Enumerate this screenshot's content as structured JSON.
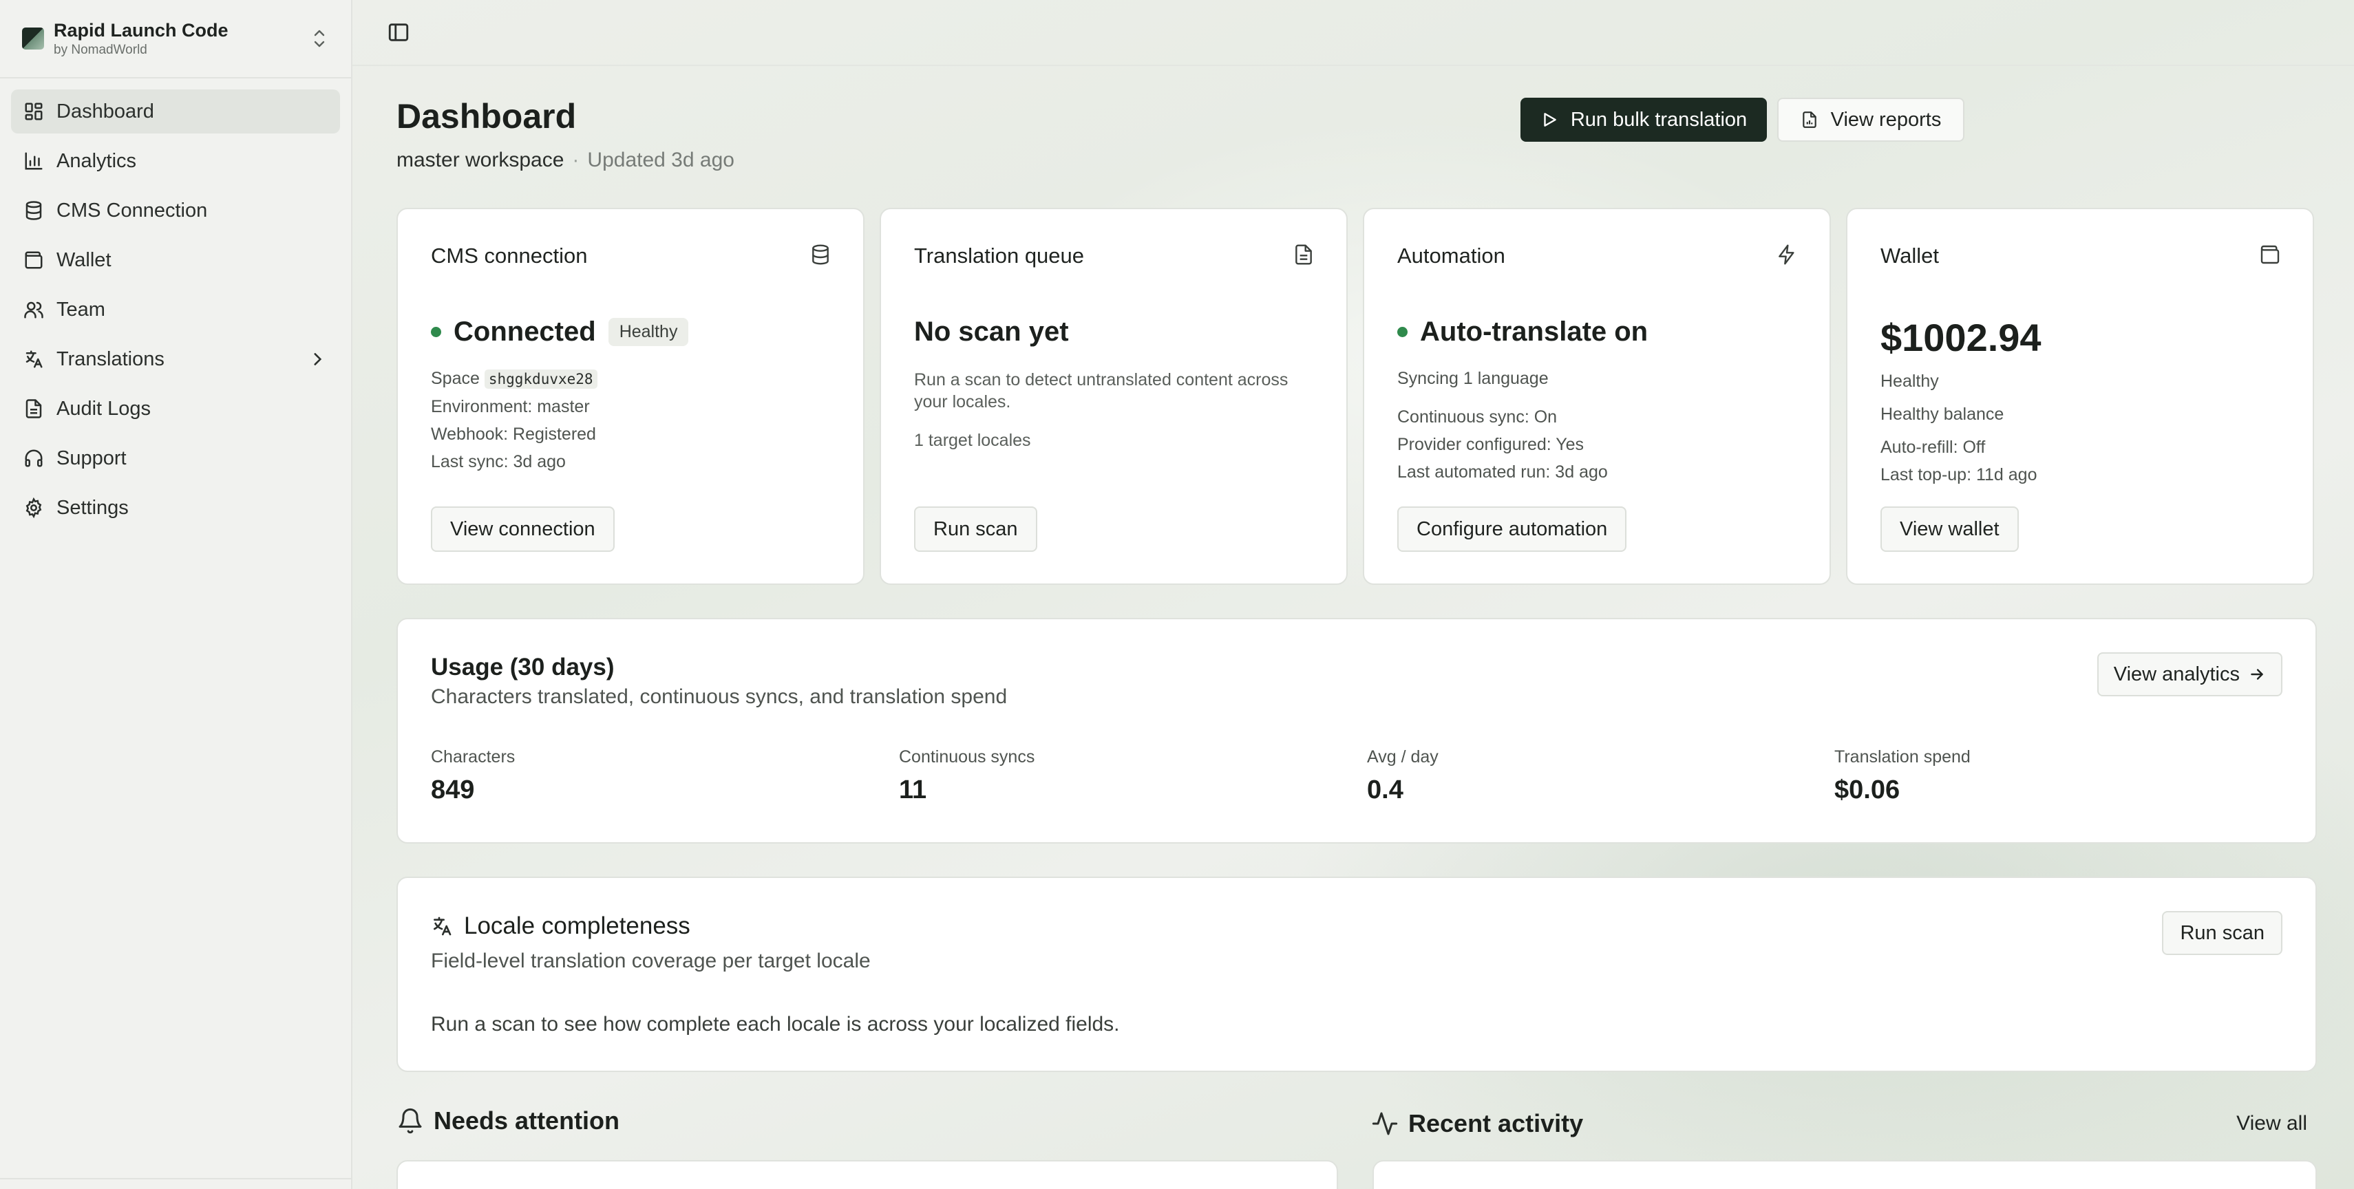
{
  "brand": {
    "name": "Rapid Launch Code",
    "by": "by NomadWorld"
  },
  "sidebar": {
    "items": [
      {
        "label": "Dashboard",
        "icon": "grid-icon",
        "active": true
      },
      {
        "label": "Analytics",
        "icon": "bar-chart-icon"
      },
      {
        "label": "CMS Connection",
        "icon": "database-icon"
      },
      {
        "label": "Wallet",
        "icon": "wallet-icon"
      },
      {
        "label": "Team",
        "icon": "users-icon"
      },
      {
        "label": "Translations",
        "icon": "languages-icon",
        "expandable": true
      },
      {
        "label": "Audit Logs",
        "icon": "file-text-icon"
      },
      {
        "label": "Support",
        "icon": "headphones-icon"
      },
      {
        "label": "Settings",
        "icon": "gear-icon"
      }
    ]
  },
  "header": {
    "title": "Dashboard",
    "workspace": "master workspace",
    "separator": "·",
    "updated": "Updated 3d ago",
    "primary_action": "Run bulk translation",
    "secondary_action": "View reports"
  },
  "cards": {
    "cms": {
      "title": "CMS connection",
      "status": "Connected",
      "badge": "Healthy",
      "space_label": "Space",
      "space_id": "shggkduvxe28",
      "environment": "Environment: master",
      "webhook": "Webhook: Registered",
      "last_sync": "Last sync: 3d ago",
      "button": "View connection"
    },
    "queue": {
      "title": "Translation queue",
      "status": "No scan yet",
      "description": "Run a scan to detect untranslated content across your locales.",
      "locales": "1 target locales",
      "button": "Run scan"
    },
    "automation": {
      "title": "Automation",
      "status": "Auto-translate on",
      "syncing": "Syncing 1 language",
      "continuous": "Continuous sync: On",
      "provider": "Provider configured: Yes",
      "last_run": "Last automated run: 3d ago",
      "button": "Configure automation"
    },
    "wallet": {
      "title": "Wallet",
      "amount": "$1002.94",
      "state": "Healthy",
      "balance": "Healthy balance",
      "autorefill": "Auto-refill: Off",
      "last_topup": "Last top-up: 11d ago",
      "button": "View wallet"
    }
  },
  "usage": {
    "title": "Usage (30 days)",
    "subtitle": "Characters translated, continuous syncs, and translation spend",
    "button": "View analytics",
    "stats": [
      {
        "label": "Characters",
        "value": "849"
      },
      {
        "label": "Continuous syncs",
        "value": "11"
      },
      {
        "label": "Avg / day",
        "value": "0.4"
      },
      {
        "label": "Translation spend",
        "value": "$0.06"
      }
    ]
  },
  "locale": {
    "title": "Locale completeness",
    "subtitle": "Field-level translation coverage per target locale",
    "empty": "Run a scan to see how complete each locale is across your localized fields.",
    "button": "Run scan"
  },
  "attention": {
    "title": "Needs attention"
  },
  "activity": {
    "title": "Recent activity",
    "view_all": "View all"
  },
  "colors": {
    "accent_dark": "#1c2a22",
    "status_green": "#2f8a4c"
  }
}
